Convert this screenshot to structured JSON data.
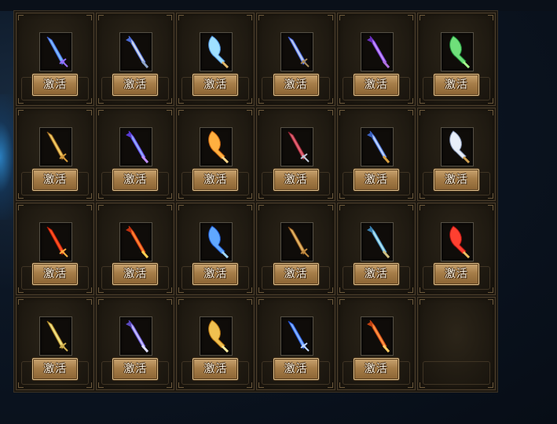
{
  "panel": {
    "rows": [
      {
        "items": [
          {
            "label": "激活",
            "weapon": "azure-spear",
            "colors": [
              "#7ab8ff",
              "#3d5fcf",
              "#9a6cff"
            ]
          },
          {
            "label": "激活",
            "weapon": "silver-trident",
            "colors": [
              "#cfd8ea",
              "#4b6bd6",
              "#8fa4c7"
            ]
          },
          {
            "label": "激活",
            "weapon": "jade-spear",
            "colors": [
              "#9fe0ff",
              "#4a8bd6",
              "#e2b86a"
            ]
          },
          {
            "label": "激活",
            "weapon": "blue-trident",
            "colors": [
              "#b8c8f0",
              "#3a58d0",
              "#a88a5a"
            ]
          },
          {
            "label": "激活",
            "weapon": "amethyst-blade",
            "colors": [
              "#c08cff",
              "#6a2fc0",
              "#b070e0"
            ]
          },
          {
            "label": "激活",
            "weapon": "emerald-blade",
            "colors": [
              "#6fe07a",
              "#1f8b3a",
              "#a8ff8c"
            ]
          }
        ]
      },
      {
        "items": [
          {
            "label": "激活",
            "weapon": "golden-trident",
            "colors": [
              "#f0c860",
              "#8a5a1c",
              "#d49a3a"
            ]
          },
          {
            "label": "激活",
            "weapon": "violet-crystal-spear",
            "colors": [
              "#8fa8ff",
              "#5a3ad6",
              "#c090ff"
            ]
          },
          {
            "label": "激活",
            "weapon": "flame-gold-blade",
            "colors": [
              "#ffb040",
              "#c06010",
              "#ffd888"
            ]
          },
          {
            "label": "激活",
            "weapon": "crimson-sword",
            "colors": [
              "#e06070",
              "#8a2030",
              "#c0c8d8"
            ]
          },
          {
            "label": "激活",
            "weapon": "steel-blue-sword",
            "colors": [
              "#b8d0ff",
              "#3a60c0",
              "#d8a040"
            ]
          },
          {
            "label": "激活",
            "weapon": "silver-broadsword",
            "colors": [
              "#e8eef8",
              "#8090b0",
              "#d0a050"
            ]
          }
        ]
      },
      {
        "items": [
          {
            "label": "激活",
            "weapon": "inferno-saber",
            "colors": [
              "#ff5020",
              "#b01a08",
              "#ffb040"
            ]
          },
          {
            "label": "激活",
            "weapon": "phoenix-blade",
            "colors": [
              "#ff8030",
              "#c03010",
              "#ffd050"
            ]
          },
          {
            "label": "激活",
            "weapon": "sapphire-sword",
            "colors": [
              "#60a8ff",
              "#1a50c0",
              "#a0d8ff"
            ]
          },
          {
            "label": "激活",
            "weapon": "bronze-scimitar",
            "colors": [
              "#e0b060",
              "#7a4818",
              "#c08a40"
            ]
          },
          {
            "label": "激活",
            "weapon": "frost-longsword",
            "colors": [
              "#a8e0f0",
              "#3a80b0",
              "#d0c080"
            ]
          },
          {
            "label": "激活",
            "weapon": "scarlet-cleaver",
            "colors": [
              "#ff4030",
              "#a01010",
              "#f0c060"
            ]
          }
        ]
      },
      {
        "items": [
          {
            "label": "激活",
            "weapon": "golden-katana",
            "colors": [
              "#f0e080",
              "#a07820",
              "#d0b050"
            ]
          },
          {
            "label": "激活",
            "weapon": "mystic-greatsword",
            "colors": [
              "#c0b8ff",
              "#5a48c0",
              "#e0e0ff"
            ]
          },
          {
            "label": "激活",
            "weapon": "sun-glaive",
            "colors": [
              "#f0c050",
              "#b07010",
              "#fff0a0"
            ]
          },
          {
            "label": "激活",
            "weapon": "lapis-spear",
            "colors": [
              "#80b0ff",
              "#2050d0",
              "#c0d8ff"
            ]
          },
          {
            "label": "激活",
            "weapon": "dragonfire-blade",
            "colors": [
              "#ff9040",
              "#c04010",
              "#ffcc60"
            ]
          },
          {
            "label": "",
            "weapon": "",
            "empty": true
          }
        ]
      }
    ]
  }
}
